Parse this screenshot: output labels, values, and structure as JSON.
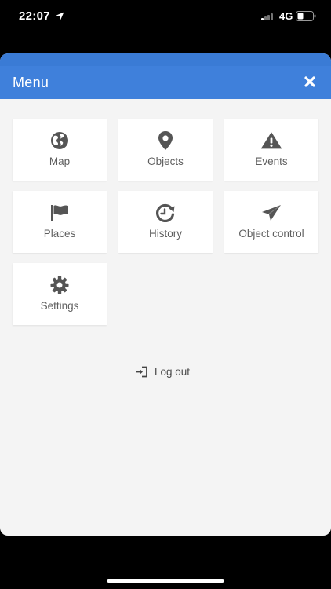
{
  "status_bar": {
    "time": "22:07",
    "network": "4G",
    "location_icon": "location-arrow-icon",
    "signal_icon": "cellular-signal-icon",
    "battery_icon": "battery-icon",
    "battery_level": 0.35
  },
  "header": {
    "title": "Menu",
    "close_icon": "close-icon",
    "color": "#3f80db"
  },
  "menu": {
    "items": [
      {
        "label": "Map",
        "icon": "globe-icon"
      },
      {
        "label": "Objects",
        "icon": "map-pin-icon"
      },
      {
        "label": "Events",
        "icon": "warning-icon"
      },
      {
        "label": "Places",
        "icon": "flag-icon"
      },
      {
        "label": "History",
        "icon": "history-icon"
      },
      {
        "label": "Object control",
        "icon": "paper-plane-icon"
      },
      {
        "label": "Settings",
        "icon": "gear-icon"
      }
    ]
  },
  "logout": {
    "label": "Log out",
    "icon": "sign-in-icon"
  },
  "colors": {
    "icon": "#555555",
    "label": "#5f5f5f",
    "background": "#f4f4f4"
  }
}
